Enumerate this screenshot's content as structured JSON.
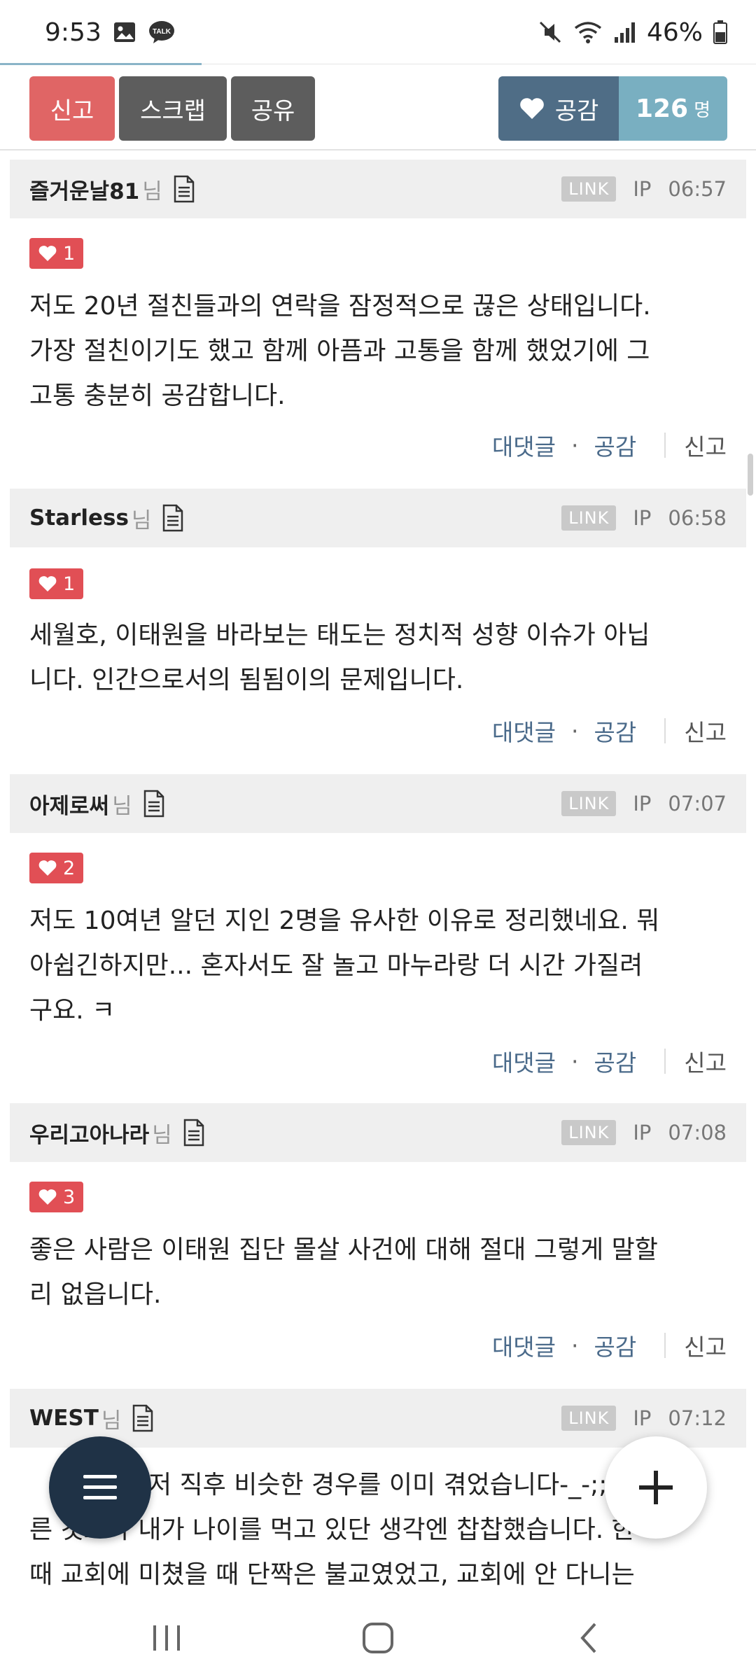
{
  "status_bar": {
    "time": "9:53",
    "talk_badge": "TALK",
    "battery": "46%"
  },
  "action_bar": {
    "report_label": "신고",
    "scrap_label": "스크랩",
    "share_label": "공유",
    "like_label": "공감",
    "like_count": "126",
    "like_unit": "명"
  },
  "comments": [
    {
      "author": "즐거운날81",
      "suffix": "님",
      "link": "LINK",
      "ip": "IP",
      "time": "06:57",
      "likes": "1",
      "lines": [
        "저도 20년 절친들과의 연락을 잠정적으로 끊은 상태입니다.",
        "가장 절친이기도 했고 함께 아픔과 고통을 함께 했었기에 그",
        "고통 충분히 공감합니다."
      ],
      "reply": "대댓글",
      "dot": "·",
      "sympathy": "공감",
      "report": "신고"
    },
    {
      "author": "Starless",
      "suffix": "님",
      "link": "LINK",
      "ip": "IP",
      "time": "06:58",
      "likes": "1",
      "lines": [
        "세월호, 이태원을 바라보는 태도는 정치적 성향 이슈가 아닙",
        "니다. 인간으로서의 됨됨이의 문제입니다."
      ],
      "reply": "대댓글",
      "dot": "·",
      "sympathy": "공감",
      "report": "신고"
    },
    {
      "author": "아제로써",
      "suffix": "님",
      "link": "LINK",
      "ip": "IP",
      "time": "07:07",
      "likes": "2",
      "lines": [
        "저도 10여년 알던 지인 2명을 유사한 이유로 정리했네요. 뭐",
        "아쉽긴하지만... 혼자서도 잘 놀고 마누라랑 더 시간 가질려",
        "구요. ㅋ"
      ],
      "reply": "대댓글",
      "dot": "·",
      "sympathy": "공감",
      "report": "신고"
    },
    {
      "author": "우리고아나라",
      "suffix": "님",
      "link": "LINK",
      "ip": "IP",
      "time": "07:08",
      "likes": "3",
      "lines": [
        "좋은 사람은 이태원 집단 몰살 사건에 대해 절대 그렇게 말할",
        "리 없읍니다."
      ],
      "reply": "대댓글",
      "dot": "·",
      "sympathy": "공감",
      "report": "신고"
    },
    {
      "author": "WEST",
      "suffix": "님",
      "link": "LINK",
      "ip": "IP",
      "time": "07:12",
      "lines": [
        "저 직후 비슷한 경우를 이미 겪었습니다-_-;; 다",
        "른 것보다 내가 나이를 먹고 있단 생각엔 찹찹했습니다. 한",
        "때 교회에 미쳤을 때 단짝은 불교였었고, 교회에 안 다니는"
      ]
    }
  ],
  "icons": {
    "gallery": "image-icon",
    "talk": "kakaotalk-icon",
    "mute": "mute-icon",
    "wifi": "wifi-icon",
    "signal": "signal-icon",
    "battery": "battery-icon",
    "heart": "heart-icon",
    "document": "document-icon",
    "menu": "hamburger-menu-icon",
    "add": "plus-icon",
    "recent": "recent-apps-icon",
    "home": "home-icon",
    "back": "back-icon"
  },
  "colors": {
    "report_red": "#e06565",
    "dark_gray": "#5d5d5d",
    "like_blue": "#4f6d86",
    "like_light": "#79afc1",
    "badge_red": "#e14f55",
    "link_blue": "#4a6a8a",
    "fab_navy": "#1f3246"
  }
}
